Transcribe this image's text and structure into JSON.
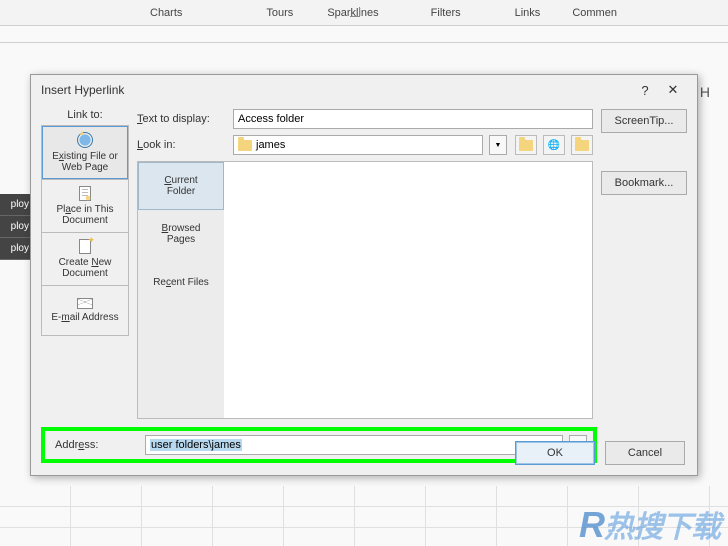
{
  "ribbon": {
    "tabs": [
      "Charts",
      "Tours",
      "Sparklines",
      "Filters",
      "Links",
      "Commen"
    ]
  },
  "column_header": "H",
  "emp_cells": [
    "ploy",
    "ploy",
    "ploy"
  ],
  "dialog": {
    "title": "Insert Hyperlink",
    "help": "?",
    "close": "✕",
    "link_to_label": "Link to:",
    "link_to_items": [
      {
        "line1_pre": "E",
        "line1_ul": "x",
        "line1_post": "isting File or",
        "line2": "Web Page"
      },
      {
        "line1_pre": "Pl",
        "line1_ul": "a",
        "line1_post": "ce in This",
        "line2": "Document"
      },
      {
        "line1_pre": "Create ",
        "line1_ul": "N",
        "line1_post": "ew",
        "line2": "Document"
      },
      {
        "line1_pre": "E-",
        "line1_ul": "m",
        "line1_post": "ail Address",
        "line2": ""
      }
    ],
    "text_to_display_label_pre": "T",
    "text_to_display_label_post": "ext to display:",
    "text_to_display_value": "Access folder",
    "look_in_label_pre": "L",
    "look_in_label_post": "ook in:",
    "look_in_value": "james",
    "browse_tabs": [
      {
        "l1_ul": "C",
        "l1": "urrent",
        "l2": "Folder"
      },
      {
        "l1_ul": "B",
        "l1": "rowsed",
        "l2": "Pages"
      },
      {
        "l1_pre": "Re",
        "l1_ul": "c",
        "l1": "ent Files",
        "l2": ""
      }
    ],
    "address_label_pre": "Addr",
    "address_label_ul": "e",
    "address_label_post": "ss:",
    "address_value": "user folders\\james",
    "screentip_btn": "ScreenTip...",
    "bookmark_btn": "Bookmark...",
    "ok_btn": "OK",
    "cancel_btn": "Cancel"
  },
  "watermark": "热搜下载"
}
